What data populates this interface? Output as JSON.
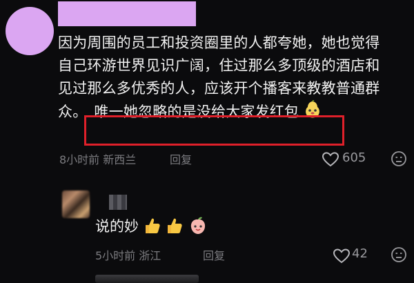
{
  "comment": {
    "lines": [
      "因为周围的员工和投资圈里的人都夸她，她也觉得",
      "自己环游世界见识广阔，住过那么多顶级的酒店和",
      "见过那么多优秀的人，应该开个播客来教教普通群",
      "众。"
    ],
    "highlight": "唯一她忽略的是没给大家发红包",
    "time_location": "8小时前 新西兰",
    "reply_label": "回复",
    "like_count": "605",
    "colors": {
      "avatar": "#dba6f2",
      "highlight_border": "#e0202a"
    }
  },
  "reply": {
    "text": "说的妙",
    "time_location": "5小时前 浙江",
    "reply_label": "回复",
    "like_count": "42"
  }
}
